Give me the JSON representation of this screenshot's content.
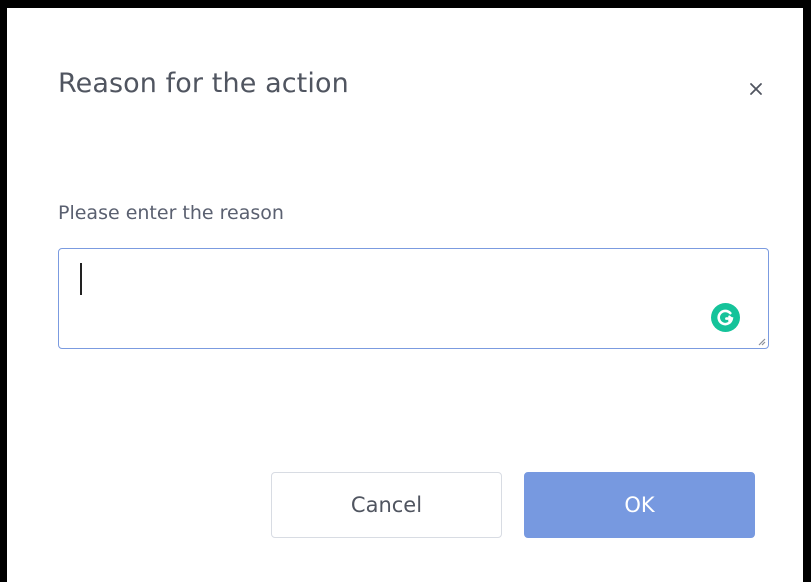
{
  "dialog": {
    "title": "Reason for the action",
    "close_icon": "close-icon"
  },
  "form": {
    "label": "Please enter the reason",
    "reason_value": "",
    "reason_placeholder": "",
    "grammar_icon": "grammarly-icon"
  },
  "actions": {
    "cancel_label": "Cancel",
    "ok_label": "OK"
  },
  "colors": {
    "accent": "#7799e0",
    "input_border": "#7b9be0",
    "grammar_badge": "#15c39a",
    "frame_border": "#000000"
  }
}
